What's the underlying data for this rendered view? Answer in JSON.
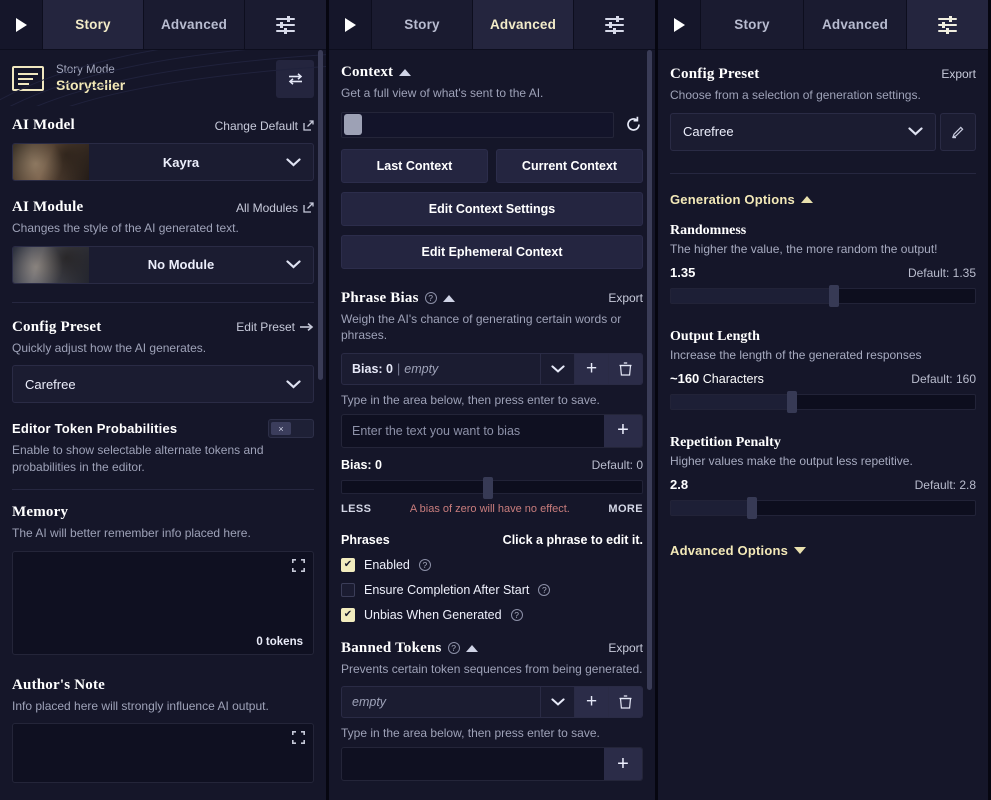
{
  "panels": [
    {
      "tabs": [
        {
          "label": "Story",
          "active": true
        },
        {
          "label": "Advanced",
          "active": false
        },
        {
          "label": "",
          "icon": "sliders-icon",
          "active": false
        }
      ],
      "story_mode": {
        "label": "Story Mode",
        "value": "Storyteller",
        "swap_icon": "swap-arrows-icon"
      },
      "ai_model": {
        "title": "AI Model",
        "action": "Change Default",
        "action_icon": "external-link-icon",
        "value": "Kayra"
      },
      "ai_module": {
        "title": "AI Module",
        "action": "All Modules",
        "action_icon": "external-link-icon",
        "desc": "Changes the style of the AI generated text.",
        "value": "No Module"
      },
      "config_preset": {
        "title": "Config Preset",
        "action": "Edit Preset",
        "action_icon": "arrow-right-icon",
        "desc": "Quickly adjust how the AI generates.",
        "value": "Carefree"
      },
      "token_probabilities": {
        "title": "Editor Token Probabilities",
        "desc": "Enable to show selectable alternate tokens and probabilities in the editor.",
        "toggle_state": "off",
        "toggle_glyph": "×"
      },
      "memory": {
        "title": "Memory",
        "desc": "The AI will better remember info placed here.",
        "value": "",
        "tokens": "0 tokens",
        "expand_icon": "expand-icon"
      },
      "authors_note": {
        "title": "Author's Note",
        "desc": "Info placed here will strongly influence AI output.",
        "value": "",
        "expand_icon": "expand-icon"
      }
    },
    {
      "tabs": [
        {
          "label": "Story",
          "active": false
        },
        {
          "label": "Advanced",
          "active": true
        },
        {
          "label": "",
          "icon": "sliders-icon",
          "active": false
        }
      ],
      "context": {
        "title": "Context",
        "collapse_icon": "caret-up-icon",
        "desc": "Get a full view of what's sent to the AI.",
        "refresh_icon": "refresh-icon",
        "buttons": [
          "Last Context",
          "Current Context",
          "Edit Context Settings",
          "Edit Ephemeral Context"
        ]
      },
      "phrase_bias": {
        "title": "Phrase Bias",
        "help_icon": "question-icon",
        "collapse_icon": "caret-up-icon",
        "export": "Export",
        "desc": "Weigh the AI's chance of generating certain words or phrases.",
        "selected_bias_label": "Bias: 0",
        "selected_placeholder": "empty",
        "hint": "Type in the area below, then press enter to save.",
        "input_placeholder": "Enter the text you want to bias",
        "add_icon": "plus-icon",
        "delete_icon": "trash-icon",
        "dropdown_icon": "chevron-down-icon",
        "bias_label": "Bias: 0",
        "bias_default": "Default: 0",
        "bias_min": "LESS",
        "bias_max": "MORE",
        "bias_warning": "A bias of zero will have no effect.",
        "phrases_label": "Phrases",
        "phrases_hint": "Click a phrase to edit it.",
        "checkboxes": [
          {
            "label": "Enabled",
            "checked": true
          },
          {
            "label": "Ensure Completion After Start",
            "checked": false
          },
          {
            "label": "Unbias When Generated",
            "checked": true
          }
        ]
      },
      "banned_tokens": {
        "title": "Banned Tokens",
        "help_icon": "question-icon",
        "collapse_icon": "caret-up-icon",
        "export": "Export",
        "desc": "Prevents certain token sequences from being generated.",
        "selected_placeholder": "empty",
        "hint": "Type in the area below, then press enter to save."
      }
    },
    {
      "tabs": [
        {
          "label": "Story",
          "active": false
        },
        {
          "label": "Advanced",
          "active": false
        },
        {
          "label": "",
          "icon": "sliders-icon",
          "active": true
        }
      ],
      "config_preset": {
        "title": "Config Preset",
        "export": "Export",
        "desc": "Choose from a selection of generation settings.",
        "value": "Carefree",
        "edit_icon": "pencil-icon",
        "dropdown_icon": "chevron-down-icon"
      },
      "generation_options": {
        "title": "Generation Options",
        "collapse_icon": "caret-up-icon",
        "options": [
          {
            "name": "Randomness",
            "desc": "The higher the value, the more random the output!",
            "value": "1.35",
            "unit": "",
            "default": "Default: 1.35",
            "knob_pct": 53
          },
          {
            "name": "Output Length",
            "desc": "Increase the length of the generated responses",
            "value": "~160",
            "unit": " Characters",
            "default": "Default: 160",
            "knob_pct": 39
          },
          {
            "name": "Repetition Penalty",
            "desc": "Higher values make the output less repetitive.",
            "value": "2.8",
            "unit": "",
            "default": "Default: 2.8",
            "knob_pct": 26
          }
        ]
      },
      "advanced_options": {
        "title": "Advanced Options",
        "expand_icon": "caret-down-icon"
      }
    }
  ],
  "colors": {
    "panel_bg": "#151629",
    "accent_gold": "#f3e9b8",
    "tab_active": "#24253e",
    "warn_red": "#c97d7d"
  }
}
